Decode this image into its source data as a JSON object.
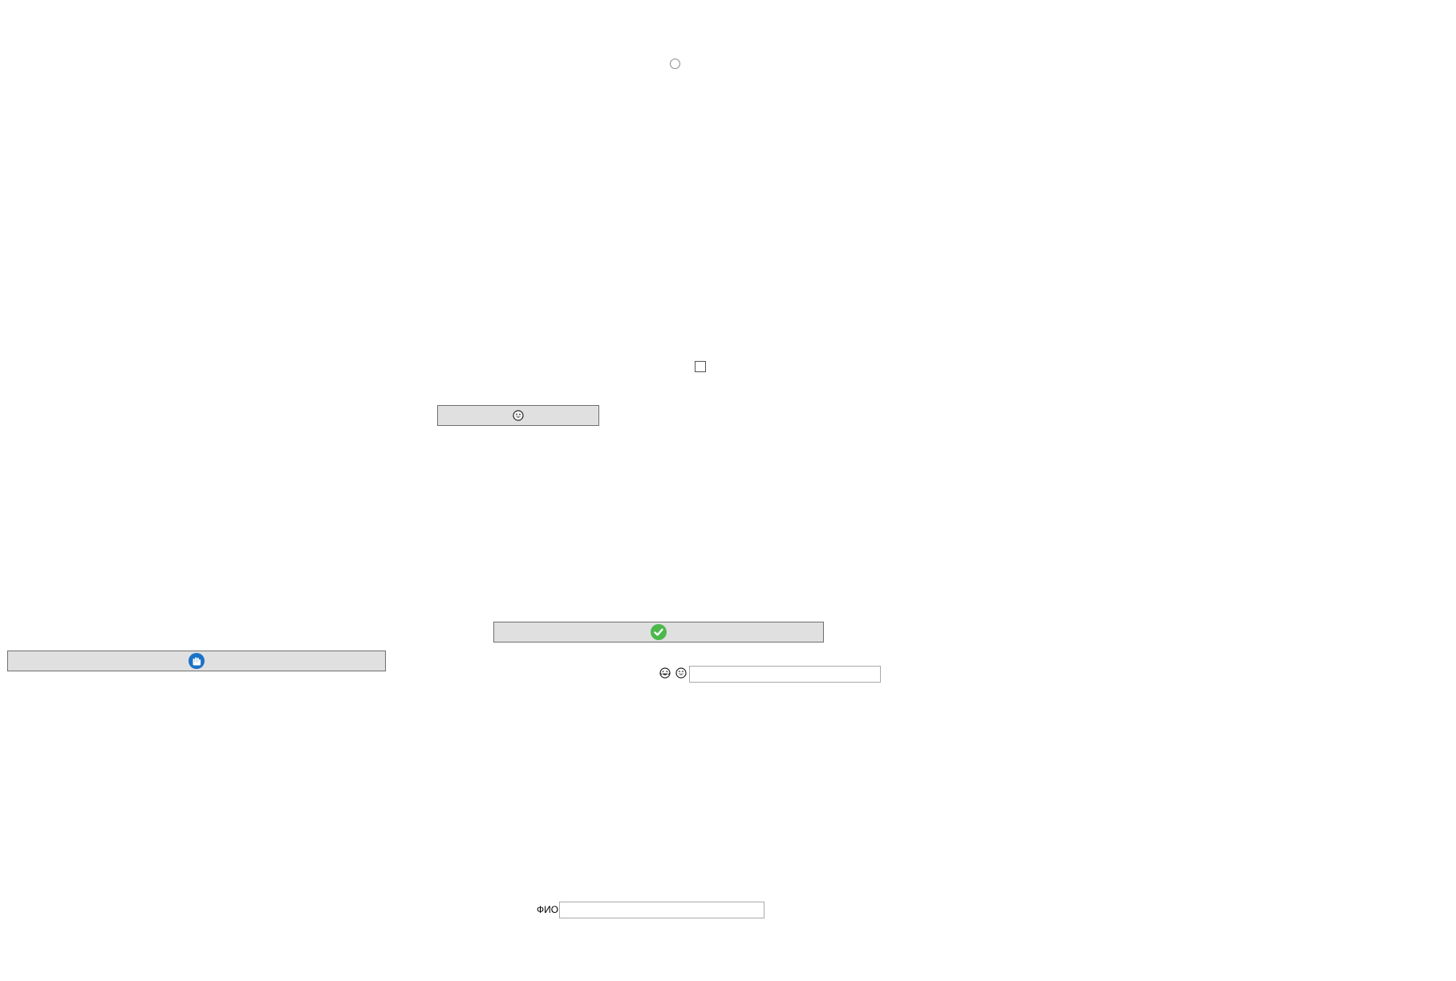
{
  "controls": {
    "radio": {
      "checked": false
    },
    "checkbox": {
      "checked": false
    }
  },
  "buttons": {
    "smiley_button": {
      "icon": "grinning-face-icon"
    },
    "check_button": {
      "icon": "green-check-circle-icon",
      "color": "#4cb84c"
    },
    "fist_button": {
      "icon": "raised-fist-icon",
      "color": "#1a73c8"
    }
  },
  "emoji_row": {
    "icons": [
      "crying-laughing-face-icon",
      "grinning-face-icon"
    ],
    "input_value": "",
    "input_placeholder": ""
  },
  "fio_field": {
    "label": "ФИО",
    "value": "",
    "placeholder": ""
  }
}
